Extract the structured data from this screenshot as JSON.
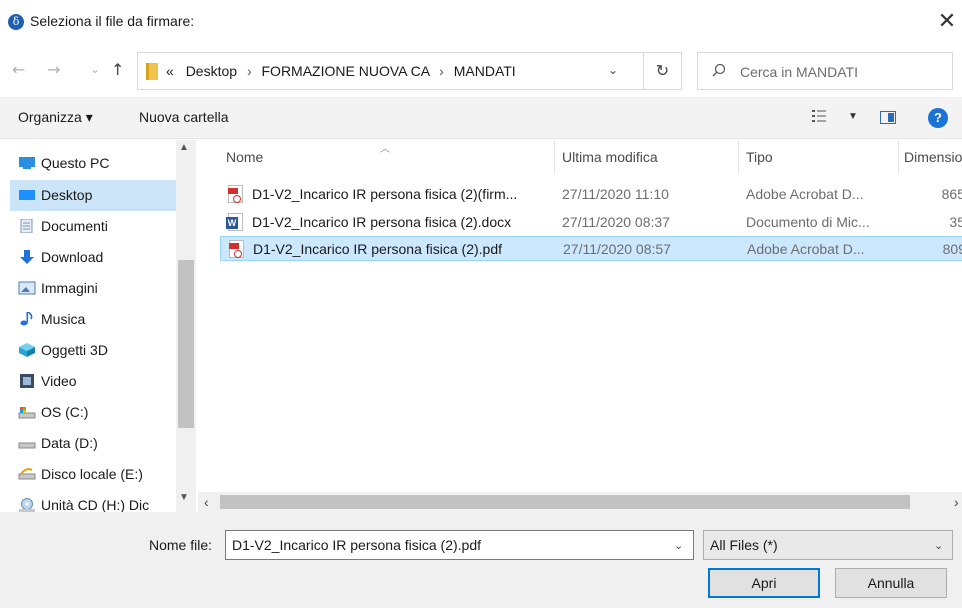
{
  "window": {
    "title": "Seleziona il file da firmare:",
    "close_glyph": "✕"
  },
  "navigation": {
    "back_glyph": "←",
    "forward_glyph": "→",
    "recent_glyph": "⌄",
    "up_glyph": "↑"
  },
  "address": {
    "overflow": "«",
    "crumbs": [
      "Desktop",
      "FORMAZIONE NUOVA CA",
      "MANDATI"
    ],
    "separator": "›",
    "dropdown_glyph": "⌄",
    "refresh_glyph": "↻"
  },
  "search": {
    "placeholder": "Cerca in MANDATI"
  },
  "toolbar": {
    "organize": "Organizza ▾",
    "new_folder": "Nuova cartella",
    "view_caret": "▼",
    "help": "?"
  },
  "sidebar": {
    "items": [
      {
        "label": "Questo PC",
        "icon": "this-pc-icon"
      },
      {
        "label": "Desktop",
        "icon": "desktop-icon",
        "selected": true
      },
      {
        "label": "Documenti",
        "icon": "documents-icon"
      },
      {
        "label": "Download",
        "icon": "download-icon"
      },
      {
        "label": "Immagini",
        "icon": "pictures-icon"
      },
      {
        "label": "Musica",
        "icon": "music-icon"
      },
      {
        "label": "Oggetti 3D",
        "icon": "3d-objects-icon"
      },
      {
        "label": "Video",
        "icon": "video-icon"
      },
      {
        "label": "OS (C:)",
        "icon": "drive-c-icon"
      },
      {
        "label": "Data (D:)",
        "icon": "drive-d-icon"
      },
      {
        "label": "Disco locale (E:)",
        "icon": "drive-e-icon"
      },
      {
        "label": "Unità CD (H:) Dic",
        "icon": "cd-drive-icon"
      }
    ]
  },
  "file_list": {
    "columns": {
      "name": "Nome",
      "modified": "Ultima modifica",
      "type": "Tipo",
      "size": "Dimensio"
    },
    "rows": [
      {
        "name": "D1-V2_Incarico IR persona fisica (2)(firm...",
        "modified": "27/11/2020 11:10",
        "type": "Adobe Acrobat D...",
        "size": "865",
        "icon": "pdf-file-icon"
      },
      {
        "name": "D1-V2_Incarico IR persona fisica (2).docx",
        "modified": "27/11/2020 08:37",
        "type": "Documento di Mic...",
        "size": "35",
        "icon": "word-file-icon"
      },
      {
        "name": "D1-V2_Incarico IR persona fisica (2).pdf",
        "modified": "27/11/2020 08:57",
        "type": "Adobe Acrobat D...",
        "size": "809",
        "icon": "pdf-file-icon",
        "selected": true
      }
    ]
  },
  "footer": {
    "filename_label": "Nome file:",
    "filename_value": "D1-V2_Incarico IR persona fisica (2).pdf",
    "filter_value": "All Files (*)",
    "open_button": "Apri",
    "cancel_button": "Annulla"
  }
}
